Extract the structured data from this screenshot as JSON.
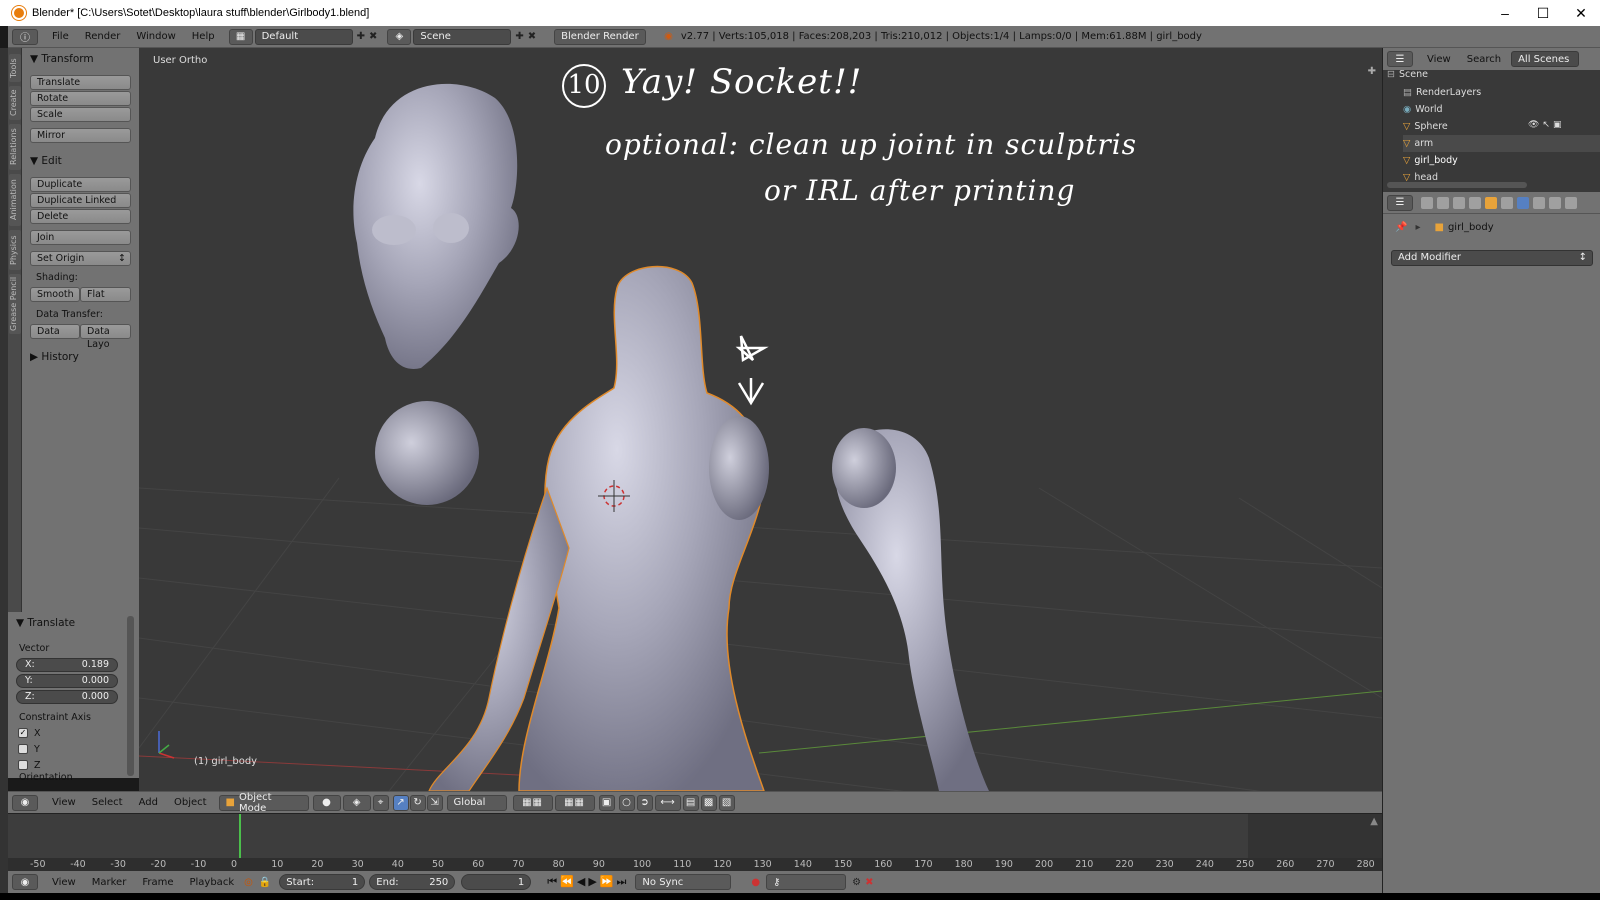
{
  "window": {
    "title": "Blender* [C:\\Users\\Sotet\\Desktop\\laura stuff\\blender\\Girlbody1.blend]"
  },
  "infobar": {
    "menus": [
      "File",
      "Render",
      "Window",
      "Help"
    ],
    "layout": "Default",
    "scene": "Scene",
    "engine": "Blender Render",
    "stats": "v2.77 | Verts:105,018 | Faces:208,203 | Tris:210,012 | Objects:1/4 | Lamps:0/0 | Mem:61.88M | girl_body"
  },
  "toolshelf": {
    "tabs": [
      "Tools",
      "Create",
      "Relations",
      "Animation",
      "Physics",
      "Grease Pencil"
    ],
    "transform_header": "Transform",
    "translate": "Translate",
    "rotate": "Rotate",
    "scale": "Scale",
    "mirror": "Mirror",
    "edit_header": "Edit",
    "duplicate": "Duplicate",
    "duplicate_linked": "Duplicate Linked",
    "delete": "Delete",
    "join": "Join",
    "set_origin": "Set Origin",
    "shading_label": "Shading:",
    "smooth": "Smooth",
    "flat": "Flat",
    "data_transfer_label": "Data Transfer:",
    "data": "Data",
    "data_layo": "Data Layo",
    "history_header": "History"
  },
  "redo_panel": {
    "header": "Translate",
    "vector_label": "Vector",
    "x_label": "X:",
    "x_value": "0.189",
    "y_label": "Y:",
    "y_value": "0.000",
    "z_label": "Z:",
    "z_value": "0.000",
    "constraint_label": "Constraint Axis",
    "cx": "X",
    "cy": "Y",
    "cz": "Z",
    "orientation_label": "Orientation"
  },
  "viewport": {
    "view_label": "User Ortho",
    "object_label": "(1) girl_body",
    "annotation_number": "10",
    "annotation_line1": "Yay! Socket!!",
    "annotation_line2": "optional: clean up joint in sculptris",
    "annotation_line3": "or IRL after printing"
  },
  "viewport_header": {
    "menus": [
      "View",
      "Select",
      "Add",
      "Object"
    ],
    "mode": "Object Mode",
    "orientation": "Global"
  },
  "timeline": {
    "ticks": [
      "-50",
      "-40",
      "-30",
      "-20",
      "-10",
      "0",
      "10",
      "20",
      "30",
      "40",
      "50",
      "60",
      "70",
      "80",
      "90",
      "100",
      "110",
      "120",
      "130",
      "140",
      "150",
      "160",
      "170",
      "180",
      "190",
      "200",
      "210",
      "220",
      "230",
      "240",
      "250",
      "260",
      "270",
      "280"
    ],
    "current_frame_value": 0
  },
  "timeline_header": {
    "menus": [
      "View",
      "Marker",
      "Frame",
      "Playback"
    ],
    "start_label": "Start:",
    "start_value": "1",
    "end_label": "End:",
    "end_value": "250",
    "current_frame": "1",
    "sync": "No Sync"
  },
  "outliner": {
    "header_view": "View",
    "header_search": "Search",
    "header_scope": "All Scenes",
    "items": [
      "Scene",
      "RenderLayers",
      "World",
      "Sphere",
      "arm",
      "girl_body",
      "head"
    ]
  },
  "properties": {
    "object_name": "girl_body",
    "add_modifier": "Add Modifier"
  }
}
